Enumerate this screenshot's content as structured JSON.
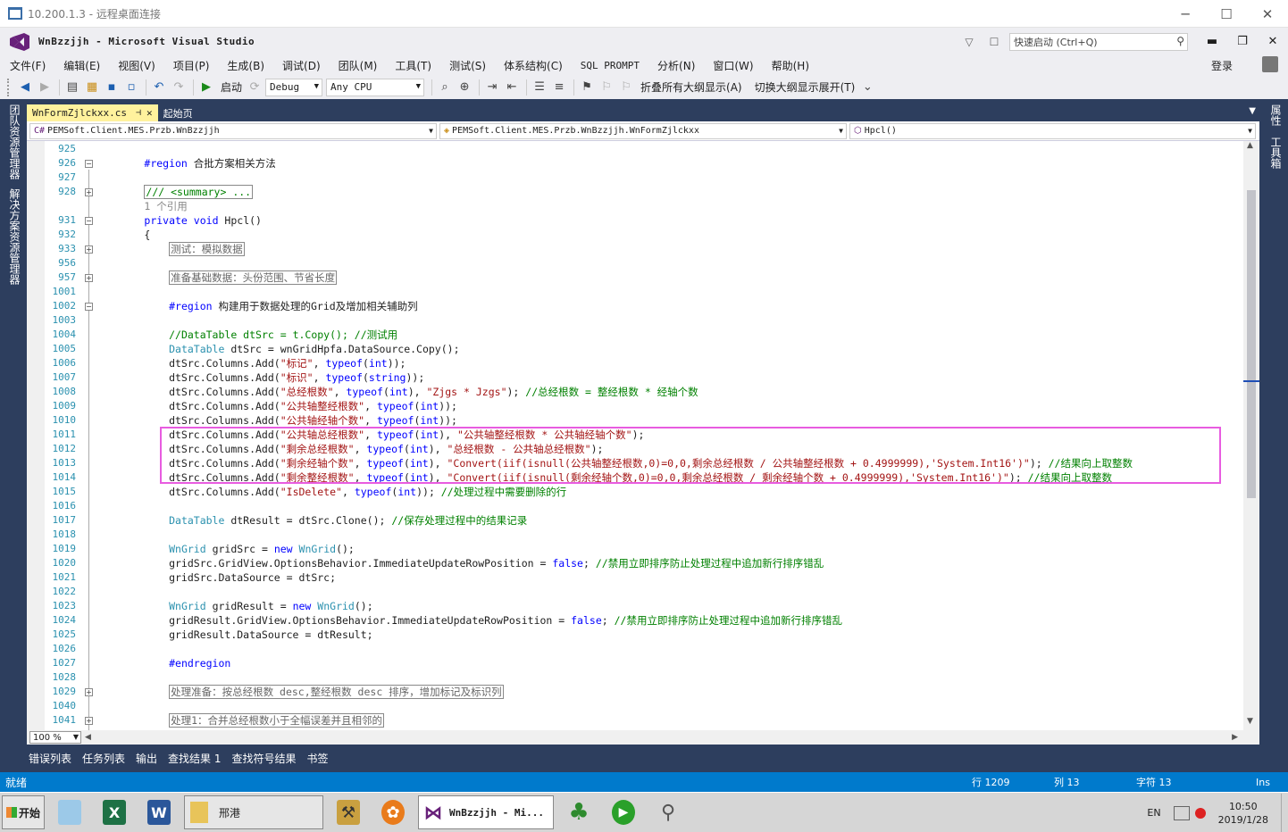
{
  "rdp": {
    "title": "10.200.1.3 - 远程桌面连接",
    "btn_minimize": "─",
    "btn_maximize": "☐",
    "btn_close": "✕"
  },
  "vs": {
    "title": "WnBzzjjh - Microsoft Visual Studio",
    "quick_launch_placeholder": "快速启动 (Ctrl+Q)",
    "login": "登录",
    "filter_glyph": "▽",
    "feedback_glyph": "☐",
    "search_glyph": "⚲",
    "wbtn_minimize": "▬",
    "wbtn_restore": "❐",
    "wbtn_close": "✕"
  },
  "menu": [
    "文件(F)",
    "编辑(E)",
    "视图(V)",
    "项目(P)",
    "生成(B)",
    "调试(D)",
    "团队(M)",
    "工具(T)",
    "测试(S)",
    "体系结构(C)",
    "SQL PROMPT",
    "分析(N)",
    "窗口(W)",
    "帮助(H)"
  ],
  "toolbar": {
    "start_label": "启动",
    "start_glyph": "▶",
    "config": "Debug",
    "platform": "Any CPU",
    "collapse_all": "折叠所有大纲显示(A)",
    "toggle_outline": "切换大纲显示展开(T)",
    "glyphs": {
      "back": "◀",
      "forward": "▶",
      "new": "▤",
      "open": "▦",
      "save": "▪",
      "save_all": "▫",
      "undo": "↶",
      "redo": "↷",
      "refresh": "⟳",
      "find": "⌕",
      "attach": "⊕",
      "indent": "⇥",
      "outdent": "⇤",
      "comment": "☰",
      "uncomment": "≡",
      "bookmark": "⚑",
      "bm_prev": "⚐",
      "bm_next": "⚐",
      "overflow": "⌄"
    }
  },
  "left_panels": [
    "团队资源管理器",
    "解决方案资源管理器"
  ],
  "right_panels": [
    "属性",
    "工具箱"
  ],
  "tabs": {
    "active": "WnFormZjlckxx.cs",
    "active_pin": "⊣",
    "active_close": "✕",
    "inactive": "起始页"
  },
  "nav": {
    "project": "PEMSoft.Client.MES.Przb.WnBzzjjh",
    "class": "PEMSoft.Client.MES.Przb.WnBzzjjh.WnFormZjlckxx",
    "member": "Hpcl()"
  },
  "code_lines": [
    {
      "num": "925",
      "html": ""
    },
    {
      "num": "926",
      "fold": "minus",
      "html": "<span class='kw'>#region</span> 合批方案相关方法"
    },
    {
      "num": "927",
      "html": ""
    },
    {
      "num": "928",
      "fold": "plus",
      "html": "<span class='collapsed'><span class='cm'>/// &lt;summary&gt; ...</span></span>"
    },
    {
      "num": "",
      "html": "<span style='color:#888'>1 个引用</span>"
    },
    {
      "num": "931",
      "fold": "minus",
      "html": "<span class='kw'>private</span> <span class='kw'>void</span> Hpcl()"
    },
    {
      "num": "932",
      "html": "{"
    },
    {
      "num": "933",
      "fold": "plus",
      "html": "    <span class='collapsed'>测试：模拟数据</span>"
    },
    {
      "num": "956",
      "html": ""
    },
    {
      "num": "957",
      "fold": "plus",
      "html": "    <span class='collapsed'>准备基础数据：头份范围、节省长度</span>"
    },
    {
      "num": "1001",
      "html": ""
    },
    {
      "num": "1002",
      "fold": "minus",
      "html": "    <span class='kw'>#region</span> 构建用于数据处理的Grid及增加相关辅助列"
    },
    {
      "num": "1003",
      "html": ""
    },
    {
      "num": "1004",
      "html": "    <span class='cm'>//DataTable dtSrc = t.Copy(); //测试用</span>"
    },
    {
      "num": "1005",
      "html": "    <span class='ty'>DataTable</span> dtSrc = wnGridHpfa.DataSource.Copy();"
    },
    {
      "num": "1006",
      "html": "    dtSrc.Columns.Add(<span class='st'>\"标记\"</span>, <span class='kw'>typeof</span>(<span class='kw'>int</span>));"
    },
    {
      "num": "1007",
      "html": "    dtSrc.Columns.Add(<span class='st'>\"标识\"</span>, <span class='kw'>typeof</span>(<span class='kw'>string</span>));"
    },
    {
      "num": "1008",
      "html": "    dtSrc.Columns.Add(<span class='st'>\"总经根数\"</span>, <span class='kw'>typeof</span>(<span class='kw'>int</span>), <span class='st'>\"Zjgs * Jzgs\"</span>); <span class='cm'>//总经根数 = 整经根数 * 经轴个数</span>"
    },
    {
      "num": "1009",
      "html": "    dtSrc.Columns.Add(<span class='st'>\"公共轴整经根数\"</span>, <span class='kw'>typeof</span>(<span class='kw'>int</span>));"
    },
    {
      "num": "1010",
      "html": "    dtSrc.Columns.Add(<span class='st'>\"公共轴经轴个数\"</span>, <span class='kw'>typeof</span>(<span class='kw'>int</span>));"
    },
    {
      "num": "1011",
      "html": "    dtSrc.Columns.Add(<span class='st'>\"公共轴总经根数\"</span>, <span class='kw'>typeof</span>(<span class='kw'>int</span>), <span class='st'>\"公共轴整经根数 * 公共轴经轴个数\"</span>);"
    },
    {
      "num": "1012",
      "html": "    dtSrc.Columns.Add(<span class='st'>\"剩余总经根数\"</span>, <span class='kw'>typeof</span>(<span class='kw'>int</span>), <span class='st'>\"总经根数 - 公共轴总经根数\"</span>);"
    },
    {
      "num": "1013",
      "html": "    dtSrc.Columns.Add(<span class='st'>\"剩余经轴个数\"</span>, <span class='kw'>typeof</span>(<span class='kw'>int</span>), <span class='st'>\"Convert(iif(isnull(公共轴整经根数,0)=0,0,剩余总经根数 / 公共轴整经根数 + 0.4999999),'System.Int16')\"</span>); <span class='cm'>//结果向上取整数</span>"
    },
    {
      "num": "1014",
      "html": "    dtSrc.Columns.Add(<span class='st'>\"剩余整经根数\"</span>, <span class='kw'>typeof</span>(<span class='kw'>int</span>), <span class='st'>\"Convert(iif(isnull(剩余经轴个数,0)=0,0,剩余总经根数 / 剩余经轴个数 + 0.4999999),'System.Int16')\"</span>); <span class='cm'>//结果向上取整数</span>"
    },
    {
      "num": "1015",
      "html": "    dtSrc.Columns.Add(<span class='st'>\"IsDelete\"</span>, <span class='kw'>typeof</span>(<span class='kw'>int</span>)); <span class='cm'>//处理过程中需要删除的行</span>"
    },
    {
      "num": "1016",
      "html": ""
    },
    {
      "num": "1017",
      "html": "    <span class='ty'>DataTable</span> dtResult = dtSrc.Clone(); <span class='cm'>//保存处理过程中的结果记录</span>"
    },
    {
      "num": "1018",
      "html": ""
    },
    {
      "num": "1019",
      "html": "    <span class='ty'>WnGrid</span> gridSrc = <span class='kw'>new</span> <span class='ty'>WnGrid</span>();"
    },
    {
      "num": "1020",
      "html": "    gridSrc.GridView.OptionsBehavior.ImmediateUpdateRowPosition = <span class='kw'>false</span>; <span class='cm'>//禁用立即排序防止处理过程中追加新行排序错乱</span>"
    },
    {
      "num": "1021",
      "html": "    gridSrc.DataSource = dtSrc;"
    },
    {
      "num": "1022",
      "html": ""
    },
    {
      "num": "1023",
      "html": "    <span class='ty'>WnGrid</span> gridResult = <span class='kw'>new</span> <span class='ty'>WnGrid</span>();"
    },
    {
      "num": "1024",
      "html": "    gridResult.GridView.OptionsBehavior.ImmediateUpdateRowPosition = <span class='kw'>false</span>; <span class='cm'>//禁用立即排序防止处理过程中追加新行排序错乱</span>"
    },
    {
      "num": "1025",
      "html": "    gridResult.DataSource = dtResult;"
    },
    {
      "num": "1026",
      "html": ""
    },
    {
      "num": "1027",
      "html": "    <span class='kw'>#endregion</span>"
    },
    {
      "num": "1028",
      "html": ""
    },
    {
      "num": "1029",
      "fold": "plus",
      "html": "    <span class='collapsed'>处理准备：按总经根数 desc,整经根数 desc 排序，增加标记及标识列</span>"
    },
    {
      "num": "1040",
      "html": ""
    },
    {
      "num": "1041",
      "fold": "plus",
      "html": "    <span class='collapsed'>处理1：合并总经根数小于全幅误差并且相邻的</span>"
    }
  ],
  "zoom": "100 %",
  "panel_tabs": [
    "错误列表",
    "任务列表",
    "输出",
    "查找结果 1",
    "查找符号结果",
    "书签"
  ],
  "status": {
    "ready": "就绪",
    "line": "行 1209",
    "col": "列 13",
    "char": "字符 13",
    "mode": "Ins"
  },
  "taskbar": {
    "start": "开始",
    "folder_label": "邢港",
    "active_window": "WnBzzjjh - Mi...",
    "excel_letter": "X",
    "word_letter": "W",
    "lang": "EN",
    "time": "10:50",
    "date": "2019/1/28"
  }
}
